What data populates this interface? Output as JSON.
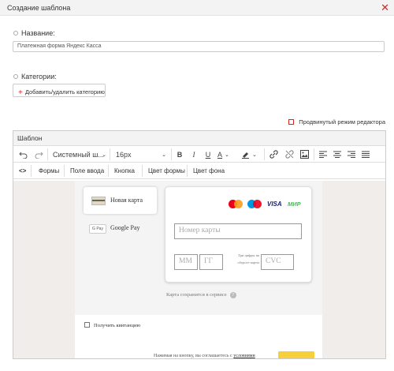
{
  "window": {
    "title": "Создание шаблона",
    "close_icon": "close-icon"
  },
  "form": {
    "name_label": "Название:",
    "name_value": "Платежная форма Яндекс Касса",
    "categories_label": "Категории:",
    "add_category_label": "Добавить/удалить категорию",
    "advanced_mode_label": "Продвинутый режим редактора"
  },
  "editor": {
    "header": "Шаблон",
    "toolbar": {
      "font_family": "Системный ш...",
      "font_size": "16px",
      "bold": "B",
      "italic": "I",
      "underline": "U",
      "font_color": "A",
      "html_toggle": "<>"
    },
    "tabs": [
      "Формы",
      "Поле ввода",
      "Кнопка",
      "Цвет формы",
      "Цвет фона"
    ],
    "preview": {
      "payment_options": [
        "Новая карта",
        "Google Pay"
      ],
      "google_pay_badge": "G Pay",
      "brands": {
        "visa": "VISA",
        "mir": "МИР"
      },
      "card_number_placeholder": "Номер карты",
      "month_placeholder": "ММ",
      "year_placeholder": "ГГ",
      "cvc_hint": "Три цифры на обороте карты",
      "cvc_placeholder": "CVC",
      "saved_note": "Карта сохранится в сервисе",
      "help_mark": "?",
      "receipt_label": "Получить квитанцию",
      "agree_text": "Нажимая на кнопку, вы соглашаетесь с",
      "agree_link": "условиями"
    }
  },
  "colors": {
    "accent": "#d22222",
    "mastercard_red": "#eb001b",
    "mastercard_yellow": "#f79e1b",
    "visa_blue": "#1a1f71",
    "mir_green": "#4db45e",
    "pay_button": "#f6cf3c",
    "canvas_bg": "#f0edea"
  }
}
